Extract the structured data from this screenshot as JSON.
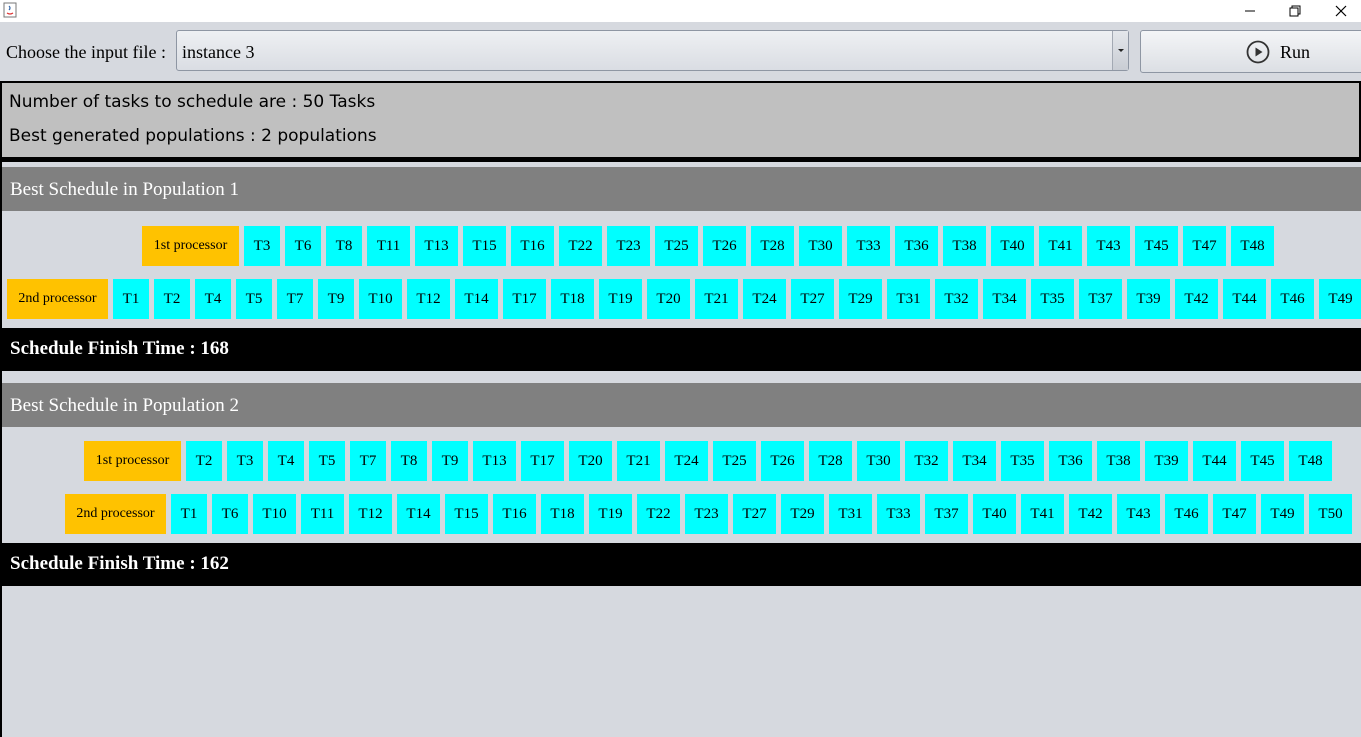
{
  "window": {
    "controls": [
      "minimize-icon",
      "restore-icon",
      "close-icon"
    ]
  },
  "toolbar": {
    "choose_label": "Choose the input file :",
    "selected_file": "instance 3",
    "run_label": "Run"
  },
  "info": {
    "tasks_line": "Number of tasks to schedule are : 50  Tasks",
    "populations_line": "Best generated populations : 2   populations"
  },
  "colors": {
    "processor": "#ffc200",
    "task": "#00ffff",
    "header": "#808080",
    "finish_bar": "#000000"
  },
  "populations": [
    {
      "title": "Best Schedule in Population 1",
      "proc1_label": "1st processor",
      "proc1_tasks": [
        "T3",
        "T6",
        "T8",
        "T11",
        "T13",
        "T15",
        "T16",
        "T22",
        "T23",
        "T25",
        "T26",
        "T28",
        "T30",
        "T33",
        "T36",
        "T38",
        "T40",
        "T41",
        "T43",
        "T45",
        "T47",
        "T48"
      ],
      "proc2_label": "2nd processor",
      "proc2_tasks": [
        "T1",
        "T2",
        "T4",
        "T5",
        "T7",
        "T9",
        "T10",
        "T12",
        "T14",
        "T17",
        "T18",
        "T19",
        "T20",
        "T21",
        "T24",
        "T27",
        "T29",
        "T31",
        "T32",
        "T34",
        "T35",
        "T37",
        "T39",
        "T42",
        "T44",
        "T46",
        "T49"
      ],
      "finish": "Schedule Finish Time : 168"
    },
    {
      "title": "Best Schedule in Population 2",
      "proc1_label": "1st processor",
      "proc1_tasks": [
        "T2",
        "T3",
        "T4",
        "T5",
        "T7",
        "T8",
        "T9",
        "T13",
        "T17",
        "T20",
        "T21",
        "T24",
        "T25",
        "T26",
        "T28",
        "T30",
        "T32",
        "T34",
        "T35",
        "T36",
        "T38",
        "T39",
        "T44",
        "T45",
        "T48"
      ],
      "proc2_label": "2nd processor",
      "proc2_tasks": [
        "T1",
        "T6",
        "T10",
        "T11",
        "T12",
        "T14",
        "T15",
        "T16",
        "T18",
        "T19",
        "T22",
        "T23",
        "T27",
        "T29",
        "T31",
        "T33",
        "T37",
        "T40",
        "T41",
        "T42",
        "T43",
        "T46",
        "T47",
        "T49",
        "T50"
      ],
      "finish": "Schedule Finish Time : 162"
    }
  ]
}
